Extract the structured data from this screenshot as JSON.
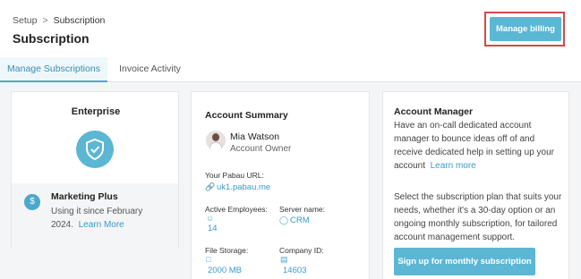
{
  "breadcrumb": {
    "parent": "Setup",
    "separator": ">",
    "current": "Subscription"
  },
  "page": {
    "title": "Subscription"
  },
  "header": {
    "billing_button": "Manage billing"
  },
  "tabs": [
    {
      "label": "Manage Subscriptions"
    },
    {
      "label": "Invoice Activity"
    }
  ],
  "plan": {
    "name": "Enterprise",
    "addon": {
      "title": "Marketing Plus",
      "text": "Using it since February 2024.",
      "link": "Learn More"
    }
  },
  "summary": {
    "title": "Account Summary",
    "owner": {
      "name": "Mia Watson",
      "role": "Account Owner"
    },
    "url_label": "Your Pabau URL:",
    "url_value": "uk1.pabau.me",
    "employees_label": "Active Employees:",
    "employees_value": "14",
    "server_label": "Server name:",
    "server_value": "CRM",
    "storage_label": "File Storage:",
    "storage_value": "2000 MB",
    "company_label": "Company ID:",
    "company_value": "14603"
  },
  "manager": {
    "title": "Account Manager",
    "text1": "Have an on-call dedicated account manager to bounce ideas off of and receive dedicated help in setting up your account",
    "link": "Learn more",
    "text2": "Select the subscription plan that suits your needs, whether it's a 30-day option or an ongoing monthly subscription, for tailored account management support.",
    "button": "Sign up for monthly subscription"
  },
  "colors": {
    "accent": "#5bb7d4",
    "highlight_outline": "#d24a4a",
    "active_tab_bg": "#eef7fa"
  }
}
